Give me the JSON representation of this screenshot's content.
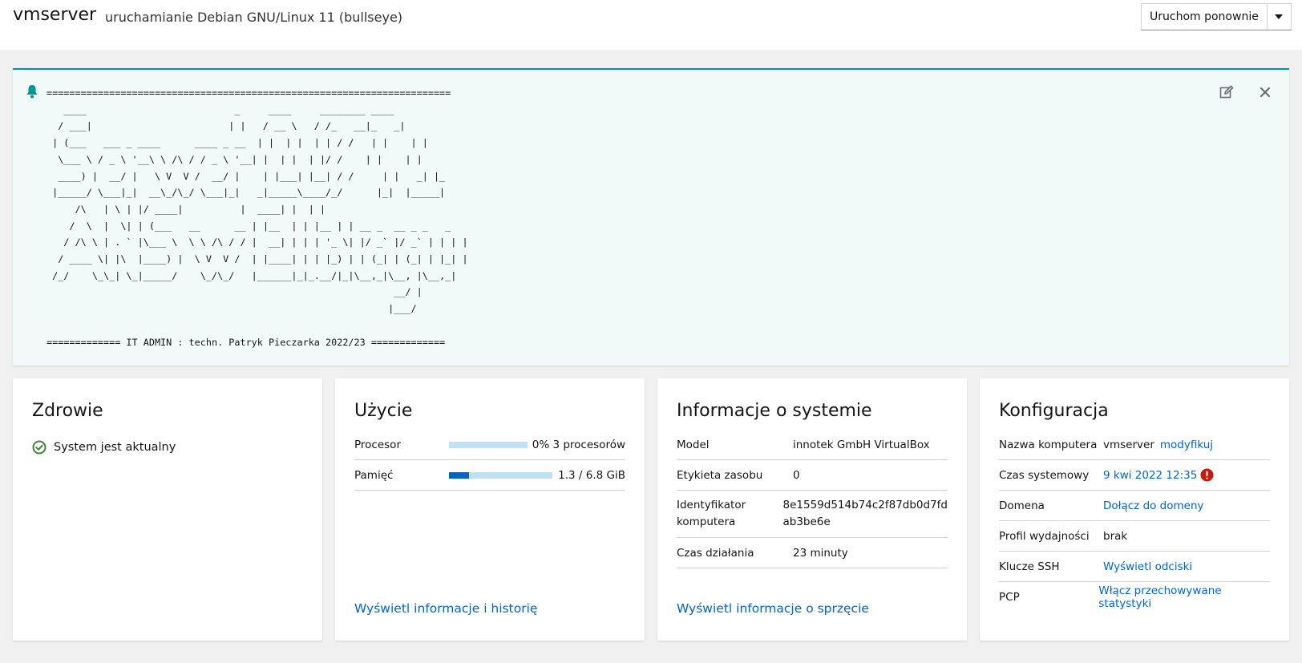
{
  "header": {
    "hostname": "vmserver",
    "status": "uruchamianie Debian GNU/Linux 11 (bullseye)",
    "restart_label": "Uruchom ponownie"
  },
  "motd": {
    "text": "=======================================================================\n   ____                          _     ____     ________ ____\n  / ___|                        | |   / __ \\   / /_   __|_   _|\n | (___   ___ _ ____      ____ _ __  | |  | |  | | / /   | |    | |\n  \\___ \\ / _ \\ '__\\ \\ /\\ / / _ \\ '__| |  | |  | |/ /    | |    | |\n  ____) |  __/ |   \\ V  V /  __/ |    | |___| |__| / /     | |   _| |_\n |_____/ \\___|_|  __\\_/\\_/ \\___|_|   _|_____\\____/_/      |_|  |_____|\n     /\\   | \\ | |/ ____|          |  ____| |  | |\n    /  \\  |  \\| | (___   __      __ | |__  | | |__ | | __ _  __ _ _   _\n   / /\\ \\ | . ` |\\___ \\  \\ \\ /\\ / / |  __| | | | '_ \\| |/ _` |/ _` | | | |\n  / ____ \\| |\\  |____) |  \\ V  V /  | |____| | | |_) | | (_| | (_| | |_| |\n /_/    \\_\\_| \\_|_____/    \\_/\\_/   |______|_|_.__/|_|\\__,_|\\__, |\\__,_|\n                                                             __/ |\n                                                            |___/\n\n============= IT ADMIN : techn. Patryk Pieczarka 2022/23 ============="
  },
  "health": {
    "title": "Zdrowie",
    "status": "System jest aktualny"
  },
  "usage": {
    "title": "Użycie",
    "cpu_label": "Procesor",
    "cpu_value": "0% 3 procesorów",
    "cpu_fraction": 0.0,
    "mem_label": "Pamięć",
    "mem_value": "1.3 / 6.8 GiB",
    "mem_fraction": 0.19,
    "link": "Wyświetl informacje i historię"
  },
  "sysinfo": {
    "title": "Informacje o systemie",
    "model_label": "Model",
    "model_value": "innotek GmbH VirtualBox",
    "asset_label": "Etykieta zasobu",
    "asset_value": "0",
    "machine_id_label_1": "Identyfikator",
    "machine_id_label_2": "komputera",
    "machine_id_value_1": "8e1559d514b74c2f87db0d7fd",
    "machine_id_value_2": "ab3be6e",
    "uptime_label": "Czas działania",
    "uptime_value": "23 minuty",
    "link": "Wyświetl informacje o sprzęcie"
  },
  "config": {
    "title": "Konfiguracja",
    "hostname_label": "Nazwa komputera",
    "hostname_value": "vmserver",
    "hostname_edit": "modyfikuj",
    "time_label": "Czas systemowy",
    "time_value": "9 kwi 2022 12:35",
    "domain_label": "Domena",
    "domain_value": "Dołącz do domeny",
    "profile_label": "Profil wydajności",
    "profile_value": "brak",
    "ssh_label": "Klucze SSH",
    "ssh_value": "Wyświetl odciski",
    "pcp_label": "PCP",
    "pcp_value": "Włącz przechowywane statystyki"
  },
  "colors": {
    "accent": "#009596",
    "link": "#0066cc",
    "success": "#3e8635",
    "danger": "#c9190b",
    "bar_bg": "#bee1f4",
    "bar_fill": "#0066cc"
  }
}
